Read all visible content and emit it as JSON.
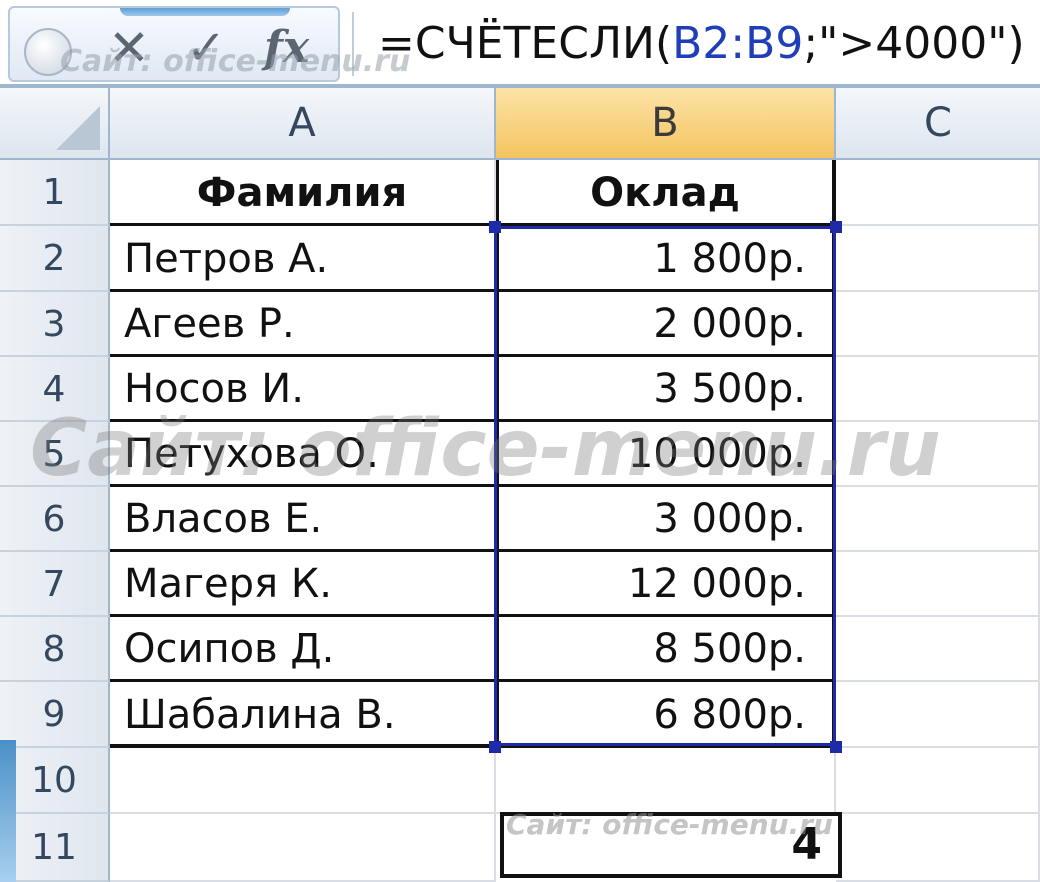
{
  "formula_bar": {
    "buttons": {
      "cancel": "✕",
      "enter": "✓",
      "insert_function": "fx"
    },
    "formula_prefix": "=СЧЁТЕСЛИ(",
    "formula_ref": "B2:B9",
    "formula_suffix": ";\">4000\")"
  },
  "watermark": {
    "large": "Сайт: office-menu.ru",
    "small_top": "Сайт: office-menu.ru",
    "small_bottom": "Сайт: office-menu.ru"
  },
  "columns": [
    "A",
    "B",
    "C"
  ],
  "selected_column": "B",
  "row_numbers": [
    "1",
    "2",
    "3",
    "4",
    "5",
    "6",
    "7",
    "8",
    "9",
    "10",
    "11"
  ],
  "table": {
    "headers": {
      "name": "Фамилия",
      "salary": "Оклад"
    },
    "rows": [
      {
        "name": "Петров А.",
        "salary": "1 800р."
      },
      {
        "name": "Агеев Р.",
        "salary": "2 000р."
      },
      {
        "name": "Носов И.",
        "salary": "3 500р."
      },
      {
        "name": "Петухова О.",
        "salary": "10 000р."
      },
      {
        "name": "Власов Е.",
        "salary": "3 000р."
      },
      {
        "name": "Магеря К.",
        "salary": "12 000р."
      },
      {
        "name": "Осипов Д.",
        "salary": "8 500р."
      },
      {
        "name": "Шабалина В.",
        "salary": "6 800р."
      }
    ]
  },
  "result": {
    "value": "4"
  },
  "colors": {
    "selection_border": "#1f2aa8",
    "selected_header": "#f6c461",
    "formula_ref": "#1f3fb8"
  }
}
